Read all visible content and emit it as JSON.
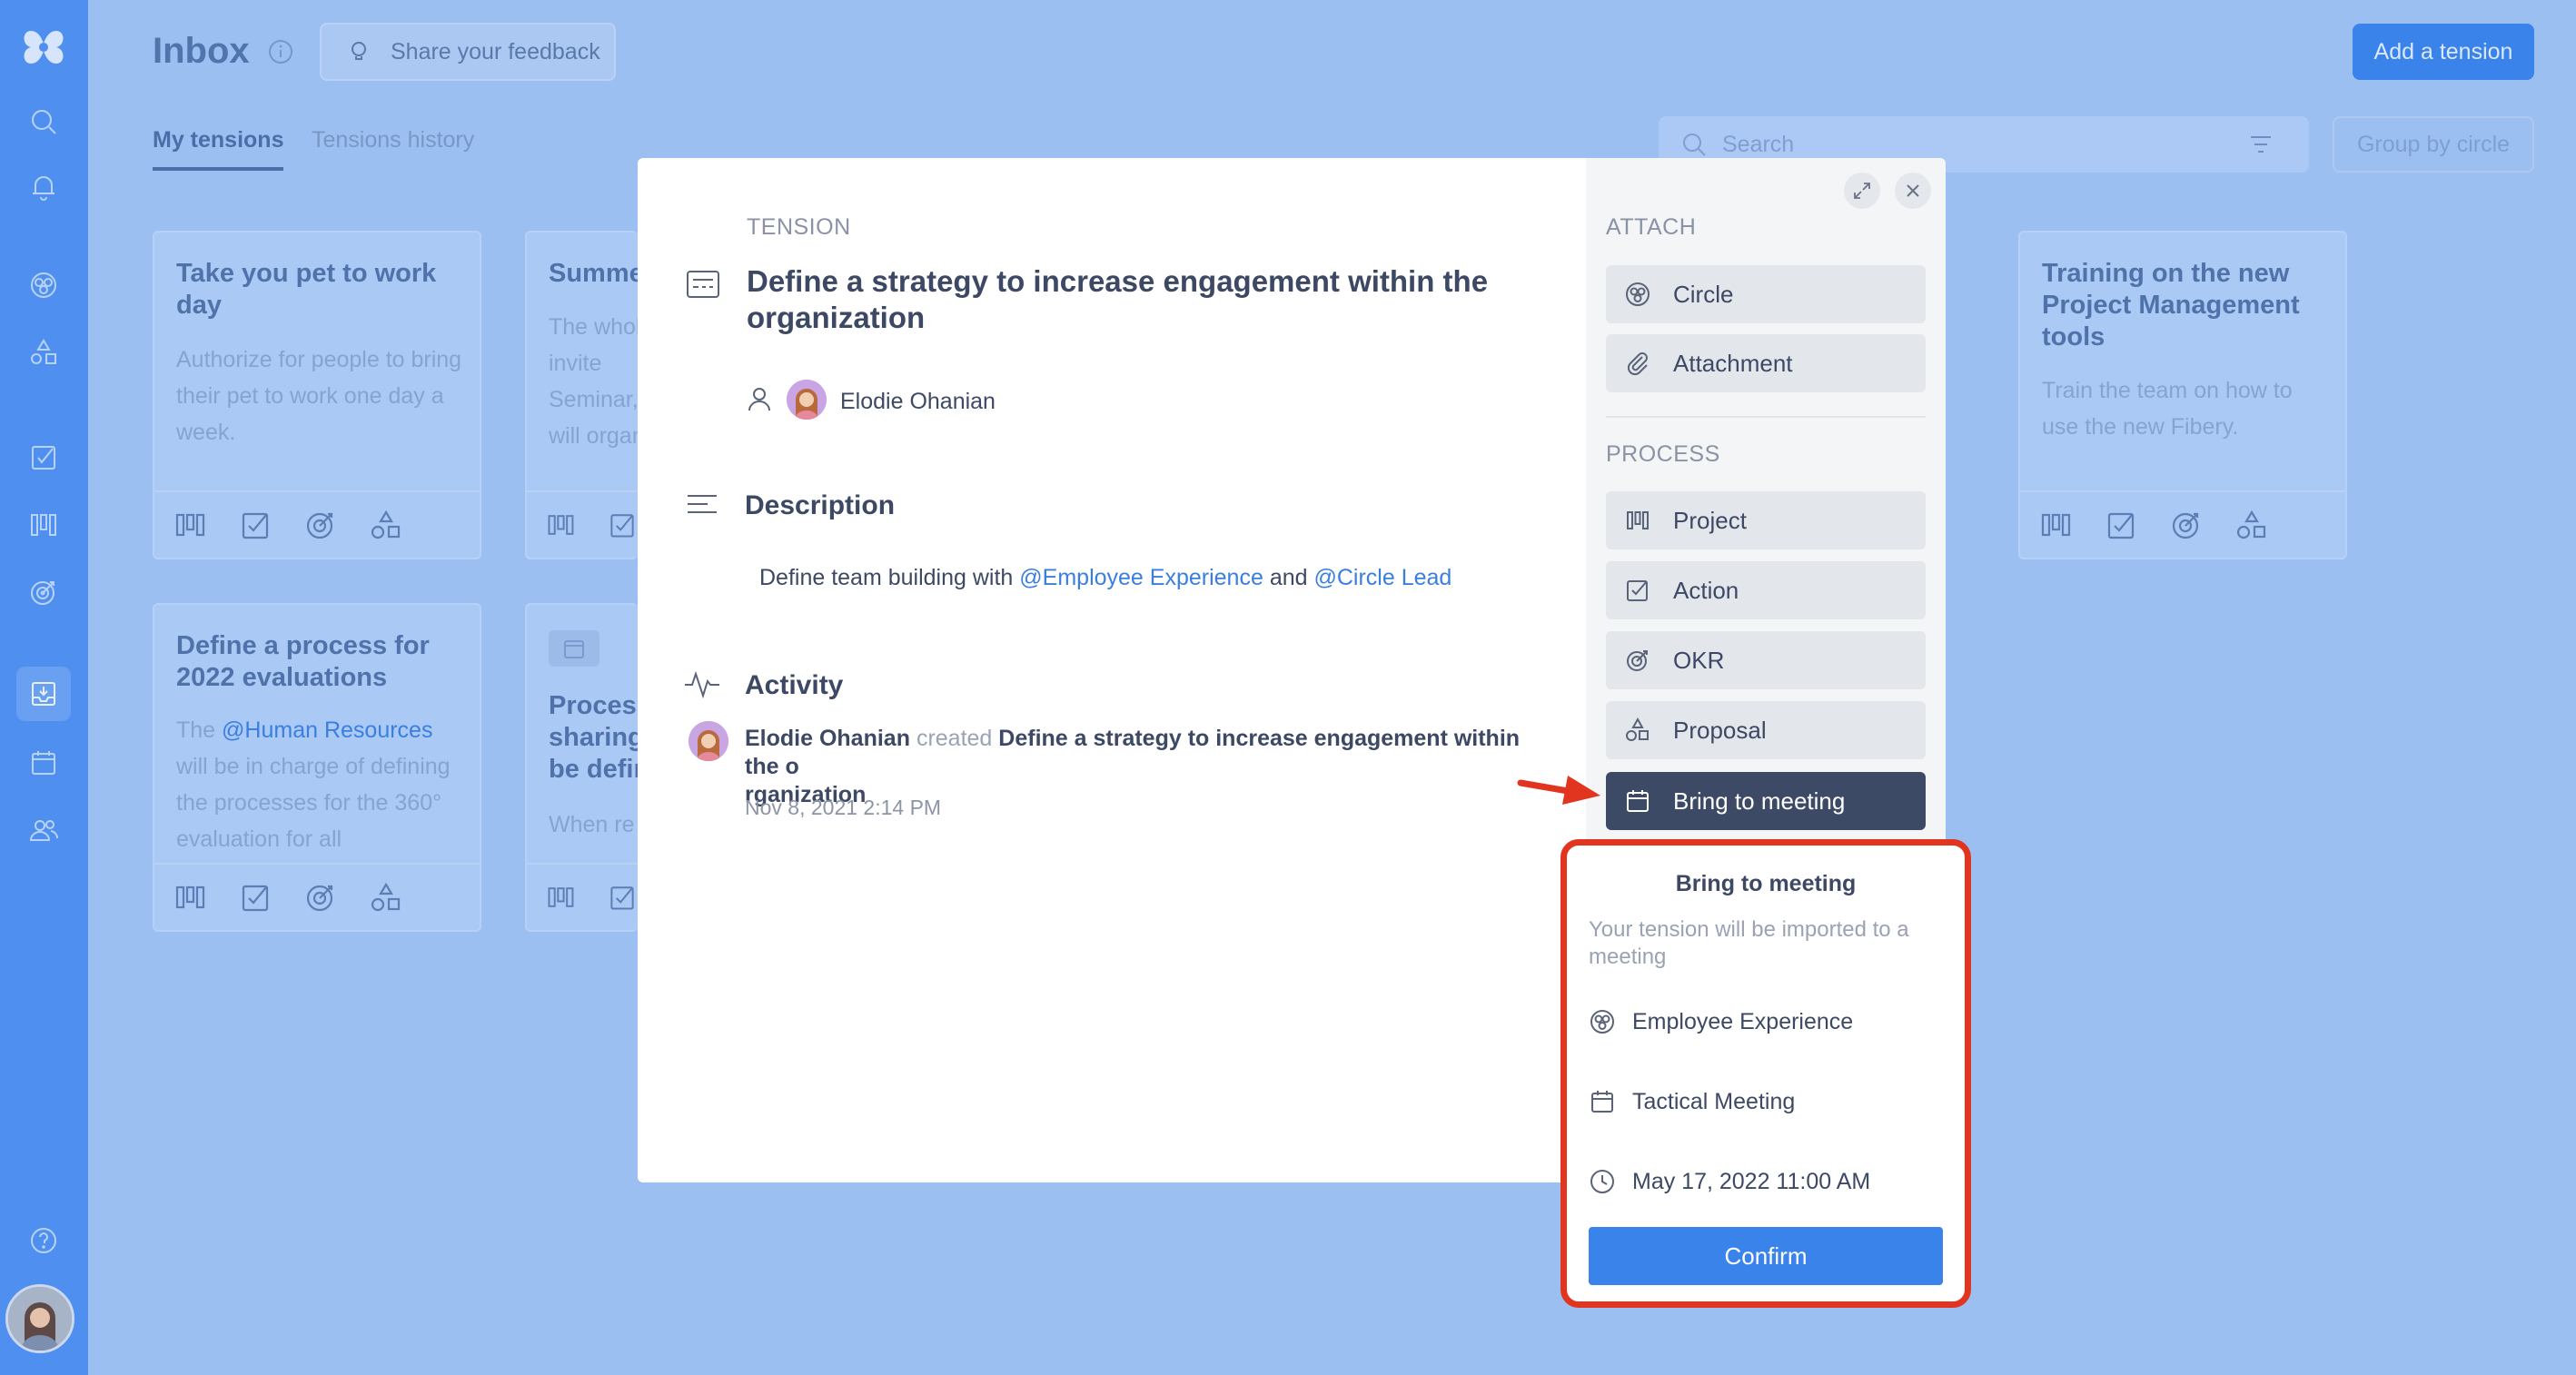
{
  "header": {
    "title": "Inbox",
    "feedback_label": "Share your feedback",
    "add_label": "Add a tension"
  },
  "tabs": [
    {
      "label": "My tensions",
      "active": true
    },
    {
      "label": "Tensions history",
      "active": false
    }
  ],
  "toolbar": {
    "search_placeholder": "Search",
    "group_label": "Group by circle"
  },
  "cards": [
    {
      "title": "Take you pet to work day",
      "text": "Authorize for people to bring their pet to work one day a week."
    },
    {
      "title": "Summe",
      "text": "The whol be invite Seminar, who will organiz"
    },
    {
      "title": "Training on the new Project Management tools",
      "text": "Train the team on how to use the new Fibery."
    },
    {
      "title": "Define a process for 2022 evaluations",
      "text_prefix": "The",
      "mention": "@Human Resources",
      "text_suffix": "will be in charge of defining the processes for the 360° evaluation for all"
    },
    {
      "title": "Process sharing be defir",
      "text": "When re"
    }
  ],
  "modal": {
    "section_label": "TENSION",
    "title": "Define a strategy to increase engagement within the organization",
    "author": "Elodie Ohanian",
    "description_heading": "Description",
    "description_prefix": "Define team building with",
    "mention_1": "@Employee Experience",
    "description_and": "and",
    "mention_2": "@Circle Lead",
    "activity_heading": "Activity",
    "activity": {
      "actor": "Elodie Ohanian",
      "verb": "created",
      "object_line1": "Define a strategy to increase engagement within the o",
      "object_line2": "rganization",
      "date": "Nov 8, 2021 2:14 PM"
    }
  },
  "side": {
    "attach_label": "ATTACH",
    "attach": [
      {
        "label": "Circle",
        "icon": "circle-icon"
      },
      {
        "label": "Attachment",
        "icon": "paperclip-icon"
      }
    ],
    "process_label": "PROCESS",
    "process": [
      {
        "label": "Project",
        "icon": "kanban-icon"
      },
      {
        "label": "Action",
        "icon": "checkbox-icon"
      },
      {
        "label": "OKR",
        "icon": "target-icon"
      },
      {
        "label": "Proposal",
        "icon": "shapes-icon"
      },
      {
        "label": "Bring to meeting",
        "icon": "calendar-icon",
        "active": true
      }
    ]
  },
  "popover": {
    "title": "Bring to meeting",
    "description": "Your tension will be imported to a meeting",
    "circle": "Employee Experience",
    "meeting": "Tactical Meeting",
    "datetime": "May 17, 2022 11:00 AM",
    "confirm_label": "Confirm"
  },
  "colors": {
    "accent": "#3a83ea",
    "highlight_border": "#e2351f",
    "active_button": "#3d4a66"
  }
}
